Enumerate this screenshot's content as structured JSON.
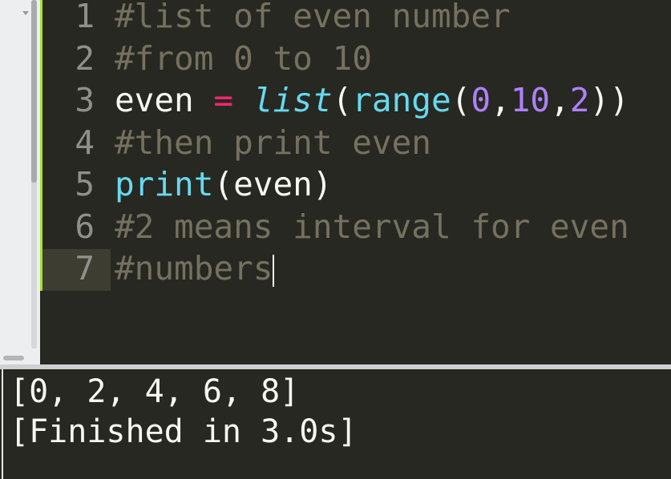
{
  "editor": {
    "lines": [
      {
        "num": "1",
        "tokens": [
          {
            "t": "#list of even number",
            "k": "comment"
          }
        ]
      },
      {
        "num": "2",
        "tokens": [
          {
            "t": "#from 0 to 10",
            "k": "comment"
          }
        ]
      },
      {
        "num": "3",
        "tokens": [
          {
            "t": "even ",
            "k": "plain"
          },
          {
            "t": "=",
            "k": "operator"
          },
          {
            "t": " ",
            "k": "plain"
          },
          {
            "t": "list",
            "k": "builtin-italic"
          },
          {
            "t": "(",
            "k": "plain"
          },
          {
            "t": "range",
            "k": "builtin"
          },
          {
            "t": "(",
            "k": "plain"
          },
          {
            "t": "0",
            "k": "number"
          },
          {
            "t": ",",
            "k": "plain"
          },
          {
            "t": "10",
            "k": "number"
          },
          {
            "t": ",",
            "k": "plain"
          },
          {
            "t": "2",
            "k": "number"
          },
          {
            "t": "))",
            "k": "plain"
          }
        ]
      },
      {
        "num": "4",
        "tokens": [
          {
            "t": "#then print even",
            "k": "comment"
          }
        ]
      },
      {
        "num": "5",
        "tokens": [
          {
            "t": "print",
            "k": "builtin"
          },
          {
            "t": "(even)",
            "k": "plain"
          }
        ]
      },
      {
        "num": "6",
        "tokens": [
          {
            "t": "#2 means interval for even",
            "k": "comment"
          }
        ]
      },
      {
        "num": "7",
        "tokens": [
          {
            "t": "#numbers",
            "k": "comment"
          }
        ]
      }
    ],
    "current_line": 7
  },
  "output": {
    "lines": [
      "[0, 2, 4, 6, 8]",
      "[Finished in 3.0s]"
    ]
  },
  "colors": {
    "background": "#272822",
    "comment": "#75715e",
    "plain": "#f8f8f2",
    "operator": "#f92672",
    "builtin": "#66d9ef",
    "number": "#ae81ff",
    "modified_marker": "#a6e22e"
  }
}
